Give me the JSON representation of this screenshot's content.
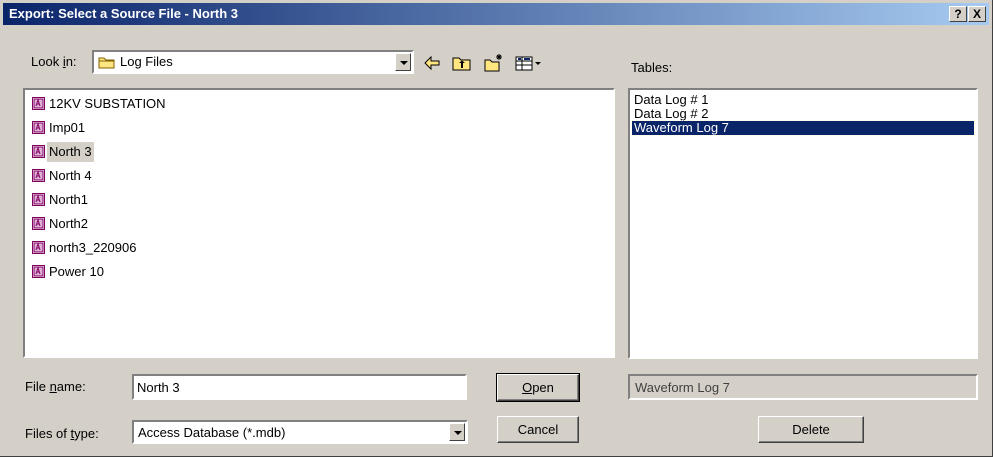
{
  "window": {
    "title": "Export: Select a Source File - North 3",
    "help_label": "?",
    "close_label": "X"
  },
  "look_in": {
    "label_pre": "Look ",
    "label_hot": "i",
    "label_post": "n:",
    "value": "Log Files"
  },
  "toolbar": {
    "icons": [
      "back-icon",
      "up-folder-icon",
      "new-folder-icon",
      "view-menu-icon"
    ]
  },
  "files": [
    {
      "name": "12KV SUBSTATION",
      "selected": false
    },
    {
      "name": "Imp01",
      "selected": false
    },
    {
      "name": "North 3",
      "selected": true
    },
    {
      "name": "North 4",
      "selected": false
    },
    {
      "name": "North1",
      "selected": false
    },
    {
      "name": "North2",
      "selected": false
    },
    {
      "name": "north3_220906",
      "selected": false
    },
    {
      "name": "Power 10",
      "selected": false
    }
  ],
  "file_name": {
    "label_pre": "File ",
    "label_hot": "n",
    "label_post": "ame:",
    "value": "North 3"
  },
  "file_type": {
    "label_pre": "Files of ",
    "label_hot": "t",
    "label_post": "ype:",
    "value": "Access Database (*.mdb)"
  },
  "buttons": {
    "open_hot": "O",
    "open_rest": "pen",
    "cancel": "Cancel",
    "delete": "Delete"
  },
  "tables": {
    "label": "Tables:",
    "items": [
      {
        "name": "Data Log # 1",
        "selected": false
      },
      {
        "name": "Data Log # 2",
        "selected": false
      },
      {
        "name": "Waveform Log 7",
        "selected": true
      }
    ],
    "selected_display": "Waveform Log 7"
  },
  "colors": {
    "titlebar_start": "#0a246a",
    "titlebar_end": "#a6caf0",
    "selection": "#0a246a",
    "face": "#d4d0c8"
  }
}
